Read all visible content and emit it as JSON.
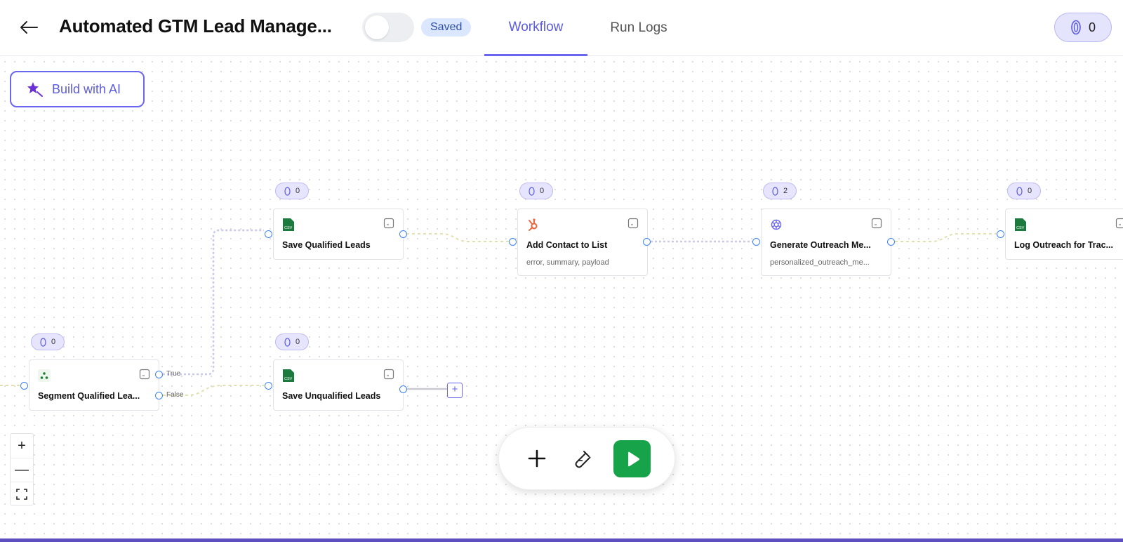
{
  "header": {
    "title": "Automated GTM Lead Manage...",
    "status_badge": "Saved",
    "tabs": [
      {
        "label": "Workflow",
        "active": true
      },
      {
        "label": "Run Logs",
        "active": false
      }
    ],
    "credits": "0"
  },
  "canvas": {
    "build_ai_label": "Build with AI",
    "nodes": [
      {
        "id": "segment",
        "title": "Segment Qualified Lea...",
        "subtitle": "",
        "credits": "0",
        "icon": "branch-icon"
      },
      {
        "id": "save-qualified",
        "title": "Save Qualified Leads",
        "subtitle": "",
        "credits": "0",
        "icon": "csv-icon"
      },
      {
        "id": "save-unqualified",
        "title": "Save Unqualified Leads",
        "subtitle": "",
        "credits": "0",
        "icon": "csv-icon"
      },
      {
        "id": "add-contact",
        "title": "Add Contact to List",
        "subtitle": "error, summary, payload",
        "credits": "0",
        "icon": "hubspot-icon"
      },
      {
        "id": "generate-outreach",
        "title": "Generate Outreach Me...",
        "subtitle": "personalized_outreach_me...",
        "credits": "2",
        "icon": "openai-icon"
      },
      {
        "id": "log-outreach",
        "title": "Log Outreach for Trac...",
        "subtitle": "",
        "credits": "0",
        "icon": "csv-icon"
      }
    ],
    "edge_labels": {
      "true": "True",
      "false": "False"
    },
    "colors": {
      "accent": "#6b66f0",
      "port": "#3b82f6",
      "run": "#16a34a"
    }
  },
  "zoom_controls": {
    "zoom_in": "+",
    "zoom_out": "—"
  }
}
